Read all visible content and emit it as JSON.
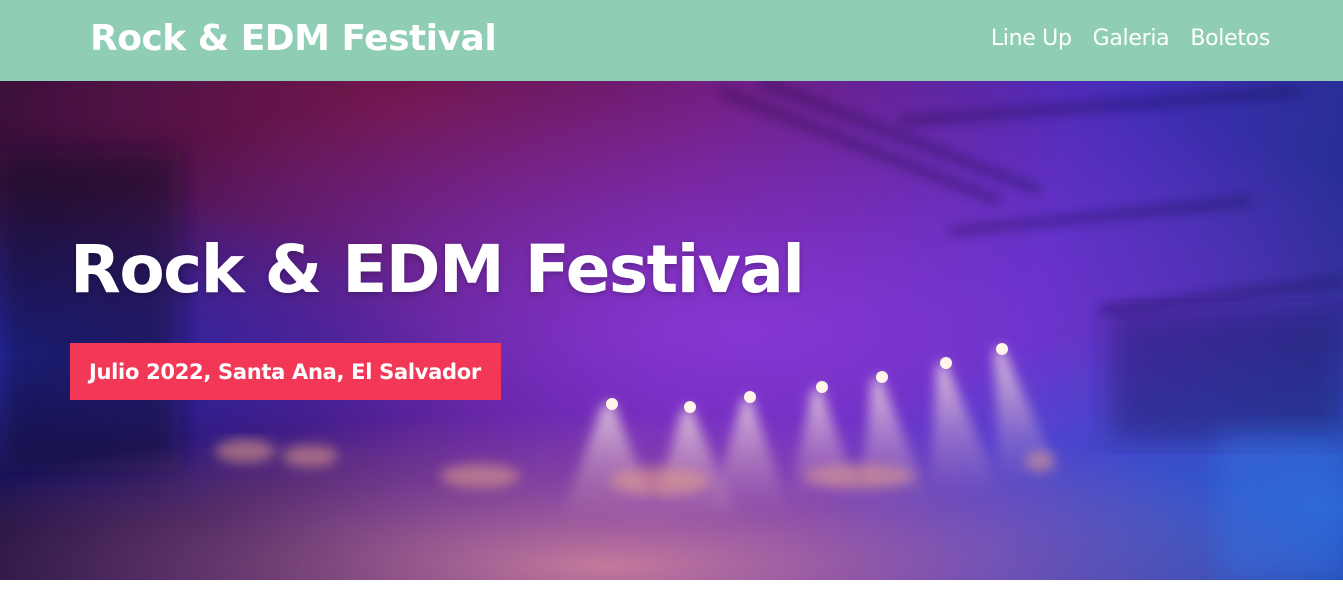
{
  "header": {
    "logo": "Rock & EDM Festival",
    "background_color": "#8fcdb4",
    "nav": [
      {
        "label": "Line Up"
      },
      {
        "label": "Galeria"
      },
      {
        "label": "Boletos"
      }
    ]
  },
  "hero": {
    "title": "Rock & EDM Festival",
    "badge": "Julio 2022, Santa Ana, El Salvador",
    "badge_color": "#f23757",
    "image": "concert-stage-lights-photo"
  }
}
